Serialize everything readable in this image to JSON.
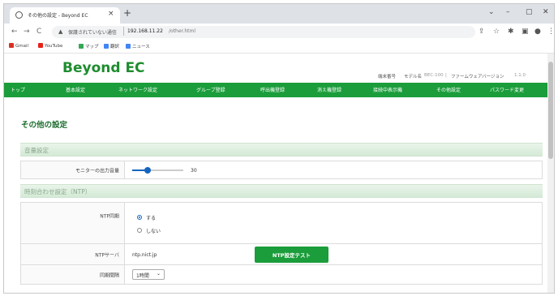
{
  "browser": {
    "tab_title": "その他の設定 - Beyond EC",
    "tab_close": "×",
    "new_tab": "+",
    "win_controls": [
      "⌄",
      "–",
      "▢",
      "✕"
    ],
    "nav": [
      "←",
      "→",
      "C"
    ],
    "security_icon": "▲",
    "security_text": "保護されていない通信",
    "url_host": "192.168.11.22",
    "url_path": "/other.html",
    "tool_icons": [
      "⇪",
      "☆",
      "✱",
      "▣",
      "●",
      "⋮"
    ],
    "bookmarks": [
      {
        "label": "Gmail",
        "icon_color": "#d93025"
      },
      {
        "label": "YouTube",
        "icon_color": "#e62117"
      },
      {
        "label": "マップ",
        "icon_color": "#34a853"
      },
      {
        "label": "翻訳",
        "icon_color": "#4285f4"
      },
      {
        "label": "ニュース",
        "icon_color": "#4285f4"
      }
    ]
  },
  "site": {
    "logo": "Beyond EC",
    "header_info": {
      "serial_label": "端末番号",
      "model_label": "モデル名",
      "model_value": "BEC-100",
      "firmware_label": "ファームウェアバージョン",
      "firmware_value": "1.1.0"
    },
    "nav": [
      "トップ",
      "基本設定",
      "ネットワーク設定",
      "グループ登録",
      "呼出機登録",
      "消え機登録",
      "接続中表示機",
      "その他設定",
      "パスワード変更"
    ],
    "brand_color": "#1a9d3a"
  },
  "page": {
    "title": "その他の設定",
    "sound_section": "音量設定",
    "monitor_label": "モニターの出力音量",
    "monitor_volume": 30,
    "monitor_volume_max": 100,
    "ntp_section": "時刻合わせ設定（NTP）",
    "ntp_sync_label": "NTP同期",
    "ntp_on": "する",
    "ntp_off": "しない",
    "ntp_server_label": "NTPサーバ",
    "ntp_server_value": "ntp.nict.jp",
    "ntp_test_button": "NTP設定テスト",
    "interval_label": "同期間隔",
    "interval_value": "1時間",
    "interval_caret": "⌄"
  }
}
